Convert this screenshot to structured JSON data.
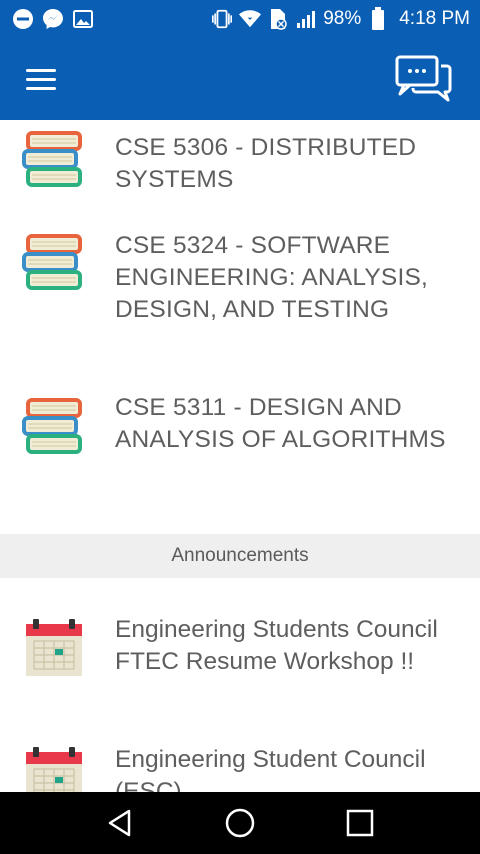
{
  "status_bar": {
    "battery": "98%",
    "time": "4:18 PM",
    "icons": [
      "minus-circle-icon",
      "messenger-icon",
      "image-icon",
      "vibrate-icon",
      "wifi-icon",
      "no-sim-icon",
      "signal-icon",
      "battery-icon"
    ]
  },
  "app_bar": {
    "menu_icon": "hamburger-menu-icon",
    "chat_icon": "chat-bubbles-icon",
    "color": "#0a5fb4"
  },
  "courses": [
    {
      "title": "CSE 5306 - DISTRIBUTED SYSTEMS",
      "icon": "books-stack-icon"
    },
    {
      "title": "CSE 5324 - SOFTWARE ENGINEERING: ANALYSIS, DESIGN, AND TESTING",
      "icon": "books-stack-icon"
    },
    {
      "title": "CSE 5311 - DESIGN AND ANALYSIS OF ALGORITHMS",
      "icon": "books-stack-icon"
    }
  ],
  "announcements": {
    "header": "Announcements",
    "items": [
      {
        "title": "Engineering Students Council FTEC Resume Workshop !!",
        "icon": "calendar-icon"
      },
      {
        "title": "Engineering Student Council (ESC)",
        "icon": "calendar-icon"
      }
    ]
  },
  "nav_bar": {
    "buttons": [
      "back-icon",
      "home-icon",
      "recents-icon"
    ]
  }
}
